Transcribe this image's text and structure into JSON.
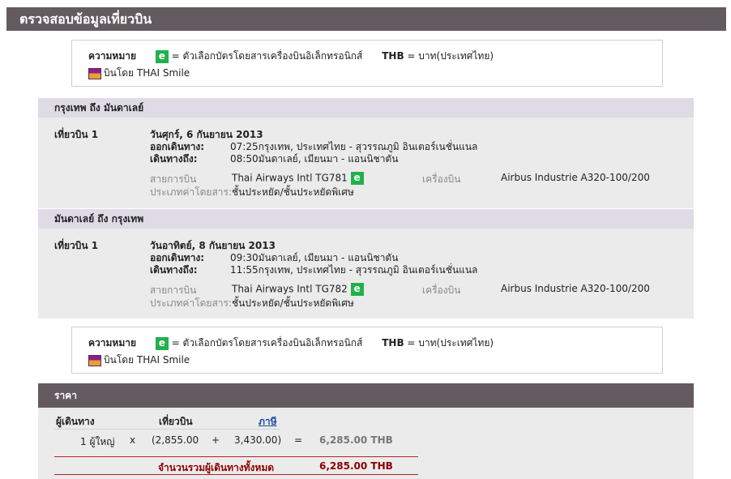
{
  "header": {
    "title": "ตรวจสอบข้อมูลเที่ยวบิน"
  },
  "legend": {
    "meaning_label": "ความหมาย",
    "e_badge": "e",
    "e_text": "= ตัวเลือกบัตรโดยสารเครื่องบินอิเล็กทรอนิกส์",
    "thb_code": "THB",
    "thb_text": "= บาท(ประเทศไทย)",
    "smile_text": "บินโดย THAI Smile"
  },
  "segments": [
    {
      "route_title": "กรุงเทพ ถึง มันดาเลย์",
      "flight_label": "เที่ยวบิน 1",
      "date": "วันศุกร์, 6 กันยายน 2013",
      "depart_label": "ออกเดินทาง:",
      "depart_value": "07:25กรุงเทพ, ประเทศไทย - สุวรรณภูมิ อินเตอร์เนชั่นแนล",
      "arrive_label": "เดินทางถึง:",
      "arrive_value": "08:50มันดาเลย์, เมียนมา - แอนนิชาตัน",
      "airline_label": "สายการบิน",
      "airline_value": "Thai Airways Intl TG781",
      "aircraft_label": "เครื่องบิน",
      "aircraft_value": "Airbus Industrie A320-100/200",
      "fare_label": "ประเภทค่าโดยสาร:",
      "fare_value": "ชั้นประหยัด/ชั้นประหยัดพิเศษ"
    },
    {
      "route_title": "มันดาเลย์ ถึง กรุงเทพ",
      "flight_label": "เที่ยวบิน 1",
      "date": "วันอาทิตย์, 8 กันยายน 2013",
      "depart_label": "ออกเดินทาง:",
      "depart_value": "09:30มันดาเลย์, เมียนมา - แอนนิชาตัน",
      "arrive_label": "เดินทางถึง:",
      "arrive_value": "11:55กรุงเทพ, ประเทศไทย - สุวรรณภูมิ อินเตอร์เนชั่นแนล",
      "airline_label": "สายการบิน",
      "airline_value": "Thai Airways Intl TG782",
      "aircraft_label": "เครื่องบิน",
      "aircraft_value": "Airbus Industrie A320-100/200",
      "fare_label": "ประเภทค่าโดยสาร:",
      "fare_value": "ชั้นประหยัด/ชั้นประหยัดพิเศษ"
    }
  ],
  "price": {
    "title": "ราคา",
    "col_passenger": "ผู้เดินทาง",
    "col_flight": "เที่ยวบิน",
    "col_tax": "ภาษี",
    "passenger": "1 ผู้ใหญ่",
    "times": "x",
    "flight_amount": "(2,855.00",
    "plus": "+",
    "tax_amount": "3,430.00)",
    "equals": "=",
    "line_total": "6,285.00 THB",
    "grand_total_label": "จำนวนรวมผู้เดินทางทั้งหมด",
    "grand_total_value": "6,285.00 THB"
  },
  "colors": {
    "header_bg": "#635b60",
    "section_title_bg": "#dedbe6",
    "section_body_bg": "#ecebeb",
    "e_badge": "#21b14b",
    "total_red": "#8b0000"
  }
}
